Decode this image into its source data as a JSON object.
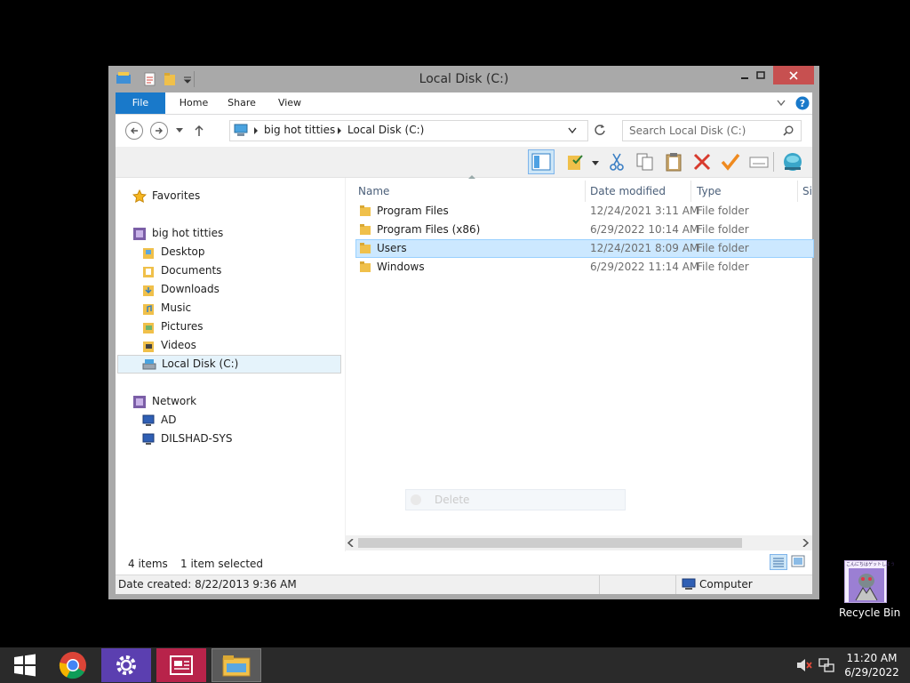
{
  "window": {
    "title": "Local Disk (C:)",
    "buttons": [
      "minimize",
      "maximize",
      "close"
    ]
  },
  "ribbon": {
    "tabs": [
      "File",
      "Home",
      "Share",
      "View"
    ]
  },
  "address": {
    "crumbs": [
      "big hot titties",
      "Local Disk (C:)"
    ],
    "search_placeholder": "Search Local Disk (C:)"
  },
  "nav": {
    "favorites": "Favorites",
    "computer": "big hot titties",
    "computer_items": [
      "Desktop",
      "Documents",
      "Downloads",
      "Music",
      "Pictures",
      "Videos",
      "Local Disk (C:)"
    ],
    "selected": "Local Disk (C:)",
    "network": "Network",
    "network_items": [
      "AD",
      "DILSHAD-SYS"
    ]
  },
  "columns": [
    "Name",
    "Date modified",
    "Type",
    "Si"
  ],
  "files": [
    {
      "name": "Program Files",
      "date": "12/24/2021 3:11 AM",
      "type": "File folder",
      "selected": false
    },
    {
      "name": "Program Files (x86)",
      "date": "6/29/2022 10:14 AM",
      "type": "File folder",
      "selected": false
    },
    {
      "name": "Users",
      "date": "12/24/2021 8:09 AM",
      "type": "File folder",
      "selected": true
    },
    {
      "name": "Windows",
      "date": "6/29/2022 11:14 AM",
      "type": "File folder",
      "selected": false
    }
  ],
  "ghost_menu": {
    "label": "Delete"
  },
  "status": {
    "count": "4 items",
    "selection": "1 item selected",
    "date_created": "Date created: 8/22/2013 9:36 AM",
    "location": "Computer"
  },
  "desktop": {
    "recycle_bin": "Recycle Bin",
    "recycle_caption": "こんにちはゲットしよう"
  },
  "taskbar": {
    "apps": [
      "start-icon",
      "chrome-icon",
      "settings-icon",
      "reader-icon",
      "file-explorer-icon"
    ],
    "time": "11:20 AM",
    "date": "6/29/2022"
  },
  "colors": {
    "file_tab": "#1979ca",
    "selection": "#cce8ff",
    "close_button": "#c75050",
    "taskbar": "#2a2a2a"
  }
}
